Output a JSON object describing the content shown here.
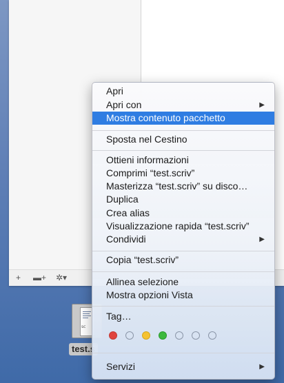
{
  "finder": {
    "bottom_buttons": {
      "add": "+",
      "new_folder": "▬+",
      "action": "✲▾"
    }
  },
  "file": {
    "badge": "sc",
    "label": "test.s"
  },
  "menu": {
    "items": [
      {
        "label": "Apri"
      },
      {
        "label": "Apri con",
        "submenu": true
      },
      {
        "label": "Mostra contenuto pacchetto",
        "selected": true
      },
      {
        "label": "Sposta nel Cestino"
      },
      {
        "label": "Ottieni informazioni"
      },
      {
        "label": "Comprimi “test.scriv”"
      },
      {
        "label": "Masterizza “test.scriv” su disco…"
      },
      {
        "label": "Duplica"
      },
      {
        "label": "Crea alias"
      },
      {
        "label": "Visualizzazione rapida “test.scriv”"
      },
      {
        "label": "Condividi",
        "submenu": true
      },
      {
        "label": "Copia “test.scriv”"
      },
      {
        "label": "Allinea selezione"
      },
      {
        "label": "Mostra opzioni Vista"
      },
      {
        "label": "Tag…"
      },
      {
        "label": "Servizi",
        "submenu": true
      }
    ],
    "submenu_arrow": "▶",
    "tag_colors": [
      "#e0443e",
      "#none",
      "#f5c231",
      "#3db93e",
      "#none",
      "#none",
      "#none"
    ]
  }
}
